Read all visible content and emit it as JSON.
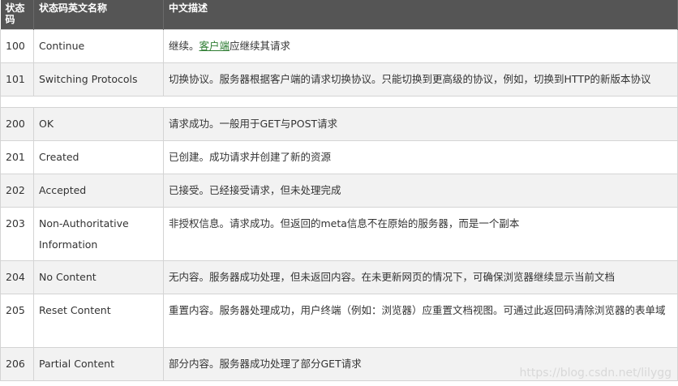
{
  "header": {
    "col_code": "状态码",
    "col_name": "状态码英文名称",
    "col_desc": "中文描述"
  },
  "rows": [
    {
      "code": "100",
      "name": "Continue",
      "desc_before": "继续。",
      "desc_link": "客户端",
      "desc_after": "应继续其请求"
    },
    {
      "code": "101",
      "name": "Switching Protocols",
      "desc": "切换协议。服务器根据客户端的请求切换协议。只能切换到更高级的协议，例如，切换到HTTP的新版本协议"
    },
    {
      "code": "200",
      "name": "OK",
      "desc": "请求成功。一般用于GET与POST请求"
    },
    {
      "code": "201",
      "name": "Created",
      "desc": "已创建。成功请求并创建了新的资源"
    },
    {
      "code": "202",
      "name": "Accepted",
      "desc": "已接受。已经接受请求，但未处理完成"
    },
    {
      "code": "203",
      "name": "Non-Authoritative Information",
      "desc": "非授权信息。请求成功。但返回的meta信息不在原始的服务器，而是一个副本"
    },
    {
      "code": "204",
      "name": "No Content",
      "desc": "无内容。服务器成功处理，但未返回内容。在未更新网页的情况下，可确保浏览器继续显示当前文档"
    },
    {
      "code": "205",
      "name": "Reset Content",
      "desc": "重置内容。服务器处理成功，用户终端（例如：浏览器）应重置文档视图。可通过此返回码清除浏览器的表单域"
    },
    {
      "code": "206",
      "name": "Partial Content",
      "desc": "部分内容。服务器成功处理了部分GET请求"
    }
  ],
  "watermark": "https://blog.csdn.net/lilygg"
}
